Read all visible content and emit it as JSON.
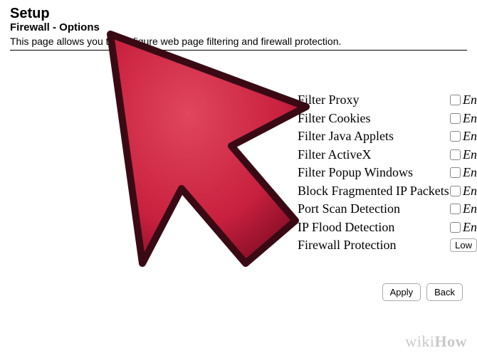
{
  "header": {
    "title": "Setup",
    "subtitle": "Firewall - Options",
    "description": "This page allows you to configure web page filtering and firewall protection."
  },
  "options": {
    "enable_suffix": "En",
    "items": [
      {
        "label": "Filter Proxy"
      },
      {
        "label": "Filter Cookies"
      },
      {
        "label": "Filter Java Applets"
      },
      {
        "label": "Filter ActiveX"
      },
      {
        "label": "Filter Popup Windows"
      },
      {
        "label": "Block Fragmented IP Packets"
      },
      {
        "label": "Port Scan Detection"
      },
      {
        "label": "IP Flood Detection"
      }
    ],
    "firewall_protection": {
      "label": "Firewall Protection",
      "value": "Low"
    }
  },
  "actions": {
    "apply": "Apply",
    "back": "Back"
  },
  "watermark": {
    "part1": "wiki",
    "part2": "How"
  },
  "cursor_icon": "large-red-arrow-cursor"
}
